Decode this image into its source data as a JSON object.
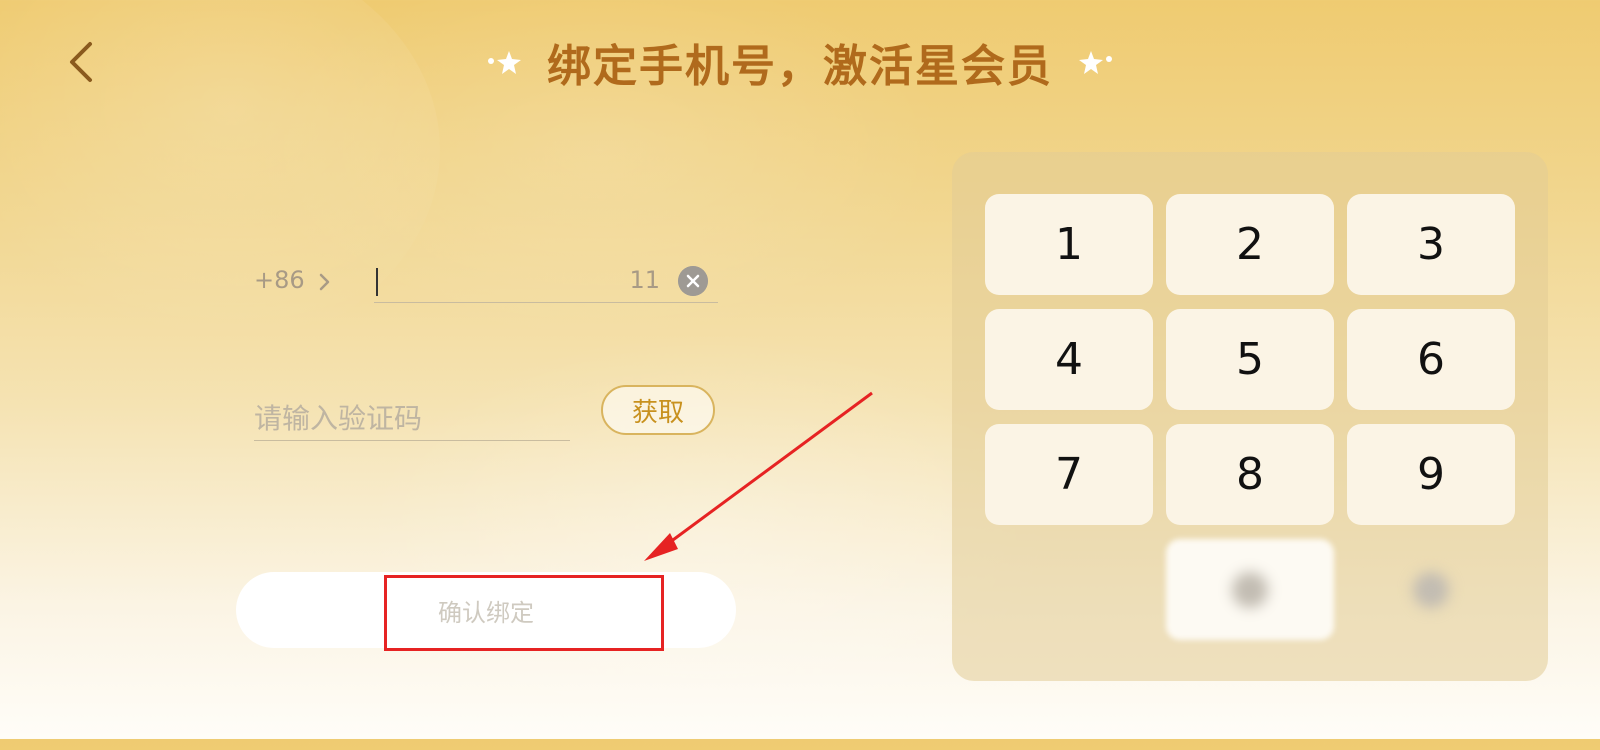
{
  "header": {
    "title": "绑定手机号，激活星会员",
    "back_icon": "chevron-left-icon",
    "decoration_icon": "sparkle-icon"
  },
  "phone": {
    "country_code": "+86",
    "country_chevron_icon": "chevron-right-icon",
    "value": "",
    "max_length_hint": "11",
    "clear_icon": "close-circle-icon"
  },
  "verification": {
    "placeholder": "请输入验证码",
    "get_code_label": "获取"
  },
  "confirm": {
    "label": "确认绑定"
  },
  "keypad": {
    "keys": [
      "1",
      "2",
      "3",
      "4",
      "5",
      "6",
      "7",
      "8",
      "9"
    ],
    "zero_key_icon": "blurred-key-icon",
    "delete_key_icon": "blurred-key-icon"
  },
  "colors": {
    "title": "#b06a1c",
    "accent": "#d9b45e",
    "highlight": "#e62323"
  }
}
